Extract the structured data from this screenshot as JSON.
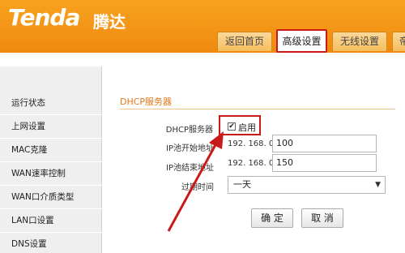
{
  "header": {
    "logo": "Tenda",
    "logo_cn": "腾达",
    "tabs": [
      "返回首页",
      "高级设置",
      "无线设置",
      "帝"
    ]
  },
  "sidebar": {
    "items": [
      "运行状态",
      "上网设置",
      "MAC克隆",
      "WAN速率控制",
      "WAN口介质类型",
      "LAN口设置",
      "DNS设置"
    ]
  },
  "main": {
    "section_title": "DHCP服务器",
    "dhcp_label": "DHCP服务器",
    "dhcp_enabled_label": "启用",
    "dhcp_checked": true,
    "start_label": "IP池开始地址",
    "start_prefix": "192. 168. 0.",
    "start_value": "100",
    "end_label": "IP池结束地址",
    "end_prefix": "192. 168. 0.",
    "end_value": "150",
    "lease_label": "过期时间",
    "lease_value": "一天",
    "ok_button": "确 定",
    "cancel_button": "取 消"
  },
  "colors": {
    "header_orange": "#f08a10",
    "highlight_red": "#c91a1a",
    "section_orange": "#e0781a"
  }
}
